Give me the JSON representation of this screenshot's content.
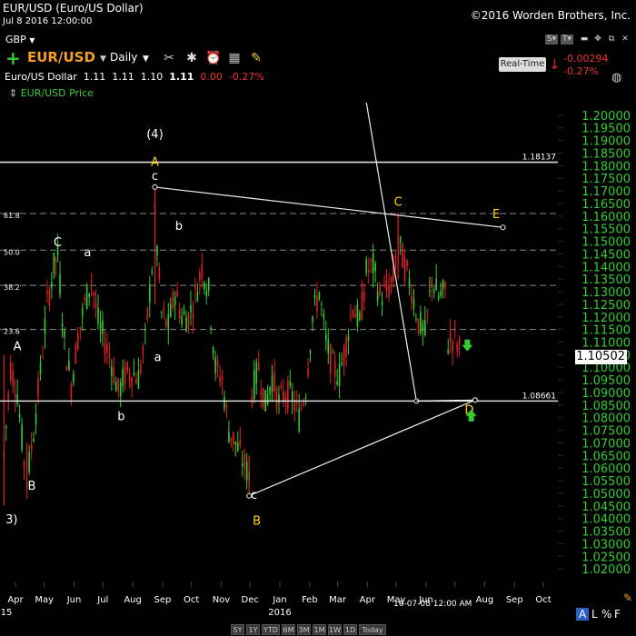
{
  "header": {
    "title": "EUR/USD (Euro/US Dollar)",
    "date": "Jul 8 2016 12:00:00",
    "copyright": "©2016 Worden Brothers, Inc.",
    "currency": "GBP",
    "symbol": "EUR/USD",
    "period": "Daily",
    "ohlc": {
      "name": "Euro/US Dollar",
      "open": "1.11",
      "high": "1.11",
      "low": "1.10",
      "close": "1.11",
      "change": "0.00",
      "change_pct": "-0.27%"
    },
    "realtime_label": "Real-Time",
    "change_abs": "-0.00294",
    "change_pct": "-0.27%",
    "legend": "EUR/USD Price"
  },
  "toolbar_icons": [
    "plus-icon",
    "tools-icon",
    "alarm-icon",
    "calculator-icon",
    "note-icon"
  ],
  "window_buttons": [
    "S▾",
    "T▾",
    "▬",
    "✥",
    "⧉",
    "✕"
  ],
  "bottom_buttons": [
    "5Y",
    "1Y",
    "YTD",
    "6M",
    "3M",
    "1M",
    "1W",
    "1D",
    "Today"
  ],
  "current_price_label": "1.10502",
  "cursor_date": "16-07-08 12:00 AM",
  "alf": [
    "A",
    "L",
    "%",
    "F"
  ],
  "colors": {
    "up": "#33cc33",
    "down": "#e02020",
    "axis_text": "#33cc33",
    "wave_yellow": "#ffd700"
  },
  "chart_data": {
    "type": "candlestick",
    "ylim": [
      1.015,
      1.205
    ],
    "y_ticks": [
      "1.20000",
      "1.19500",
      "1.19000",
      "1.18500",
      "1.18000",
      "1.17500",
      "1.17000",
      "1.16500",
      "1.16000",
      "1.15500",
      "1.15000",
      "1.14500",
      "1.14000",
      "1.13500",
      "1.13000",
      "1.12500",
      "1.12000",
      "1.11500",
      "1.11000",
      "1.10500",
      "1.10000",
      "1.09500",
      "1.09000",
      "1.08500",
      "1.08000",
      "1.07500",
      "1.07000",
      "1.06500",
      "1.06000",
      "1.05500",
      "1.05000",
      "1.04500",
      "1.04000",
      "1.03500",
      "1.03000",
      "1.02500",
      "1.02000"
    ],
    "x_ticks": [
      {
        "label": "Apr",
        "sub": "15"
      },
      {
        "label": "May"
      },
      {
        "label": "Jun"
      },
      {
        "label": "Jul"
      },
      {
        "label": "Aug"
      },
      {
        "label": "Sep"
      },
      {
        "label": "Oct"
      },
      {
        "label": "Nov"
      },
      {
        "label": "Dec"
      },
      {
        "label": "Jan",
        "sub": "2016"
      },
      {
        "label": "Feb"
      },
      {
        "label": "Mar"
      },
      {
        "label": "Apr"
      },
      {
        "label": "May"
      },
      {
        "label": "Jun"
      },
      {
        "label": "Jul"
      },
      {
        "label": "Aug"
      },
      {
        "label": "Sep"
      },
      {
        "label": "Oct"
      }
    ],
    "horizontal_lines": [
      {
        "value": 1.18137,
        "label": "1.18137"
      },
      {
        "value": 1.08661,
        "label": "1.08661"
      }
    ],
    "fib_levels": [
      {
        "value": 1.161,
        "label": "61.8"
      },
      {
        "value": 1.1465,
        "label": "50.0"
      },
      {
        "value": 1.1325,
        "label": "38.2"
      },
      {
        "value": 1.115,
        "label": "23.6"
      }
    ],
    "wave_labels": [
      {
        "text": "(4)",
        "color": "white",
        "date": "2015-08-24",
        "price": 1.191
      },
      {
        "text": "A",
        "color": "yellow",
        "date": "2015-08-24",
        "price": 1.18
      },
      {
        "text": "c",
        "color": "white",
        "date": "2015-08-24",
        "price": 1.1743
      },
      {
        "text": "C",
        "color": "white",
        "date": "2015-05-15",
        "price": 1.148
      },
      {
        "text": "a",
        "color": "white",
        "date": "2015-06-15",
        "price": 1.144
      },
      {
        "text": "b",
        "color": "white",
        "date": "2015-09-18",
        "price": 1.1545
      },
      {
        "text": "a",
        "color": "white",
        "date": "2015-08-27",
        "price": 1.1025
      },
      {
        "text": "b",
        "color": "white",
        "date": "2015-07-20",
        "price": 1.079
      },
      {
        "text": "A",
        "color": "white",
        "date": "2015-04-03",
        "price": 1.1068
      },
      {
        "text": "B",
        "color": "white",
        "date": "2015-04-18",
        "price": 1.0515
      },
      {
        "text": "3)",
        "color": "white",
        "date": "2015-03-28",
        "price": 1.038
      },
      {
        "text": "c",
        "color": "white",
        "date": "2015-12-05",
        "price": 1.0478
      },
      {
        "text": "B",
        "color": "yellow",
        "date": "2015-12-08",
        "price": 1.0375
      },
      {
        "text": "C",
        "color": "yellow",
        "date": "2016-05-03",
        "price": 1.164
      },
      {
        "text": "E",
        "color": "yellow",
        "date": "2016-08-13",
        "price": 1.1592
      },
      {
        "text": "D",
        "color": "yellow",
        "date": "2016-07-16",
        "price": 1.0815
      }
    ],
    "trendlines": [
      {
        "from": {
          "date": "2015-08-24",
          "price": 1.1715
        },
        "to": {
          "date": "2016-08-20",
          "price": 1.1555
        }
      },
      {
        "from": {
          "date": "2015-11-30",
          "price": 1.049
        },
        "to": {
          "date": "2016-07-22",
          "price": 1.087
        }
      },
      {
        "from": {
          "date": "2016-03-31",
          "price": 1.205
        },
        "to": {
          "date": "2016-05-22",
          "price": 1.0866
        }
      },
      {
        "from": {
          "date": "2016-05-22",
          "price": 1.0866
        },
        "to": {
          "date": "2016-07-22",
          "price": 1.087
        }
      }
    ],
    "arrows": [
      {
        "direction": "down",
        "color": "green",
        "date": "2016-07-14",
        "price": 1.1085
      },
      {
        "direction": "up",
        "color": "green",
        "date": "2016-07-18",
        "price": 1.081
      }
    ],
    "closes": [
      {
        "date": "2015-03-20",
        "close": 1.065
      },
      {
        "date": "2015-03-27",
        "close": 1.1
      },
      {
        "date": "2015-04-03",
        "close": 1.09
      },
      {
        "date": "2015-04-10",
        "close": 1.062
      },
      {
        "date": "2015-04-13",
        "close": 1.055
      },
      {
        "date": "2015-04-20",
        "close": 1.075
      },
      {
        "date": "2015-04-27",
        "close": 1.098
      },
      {
        "date": "2015-05-04",
        "close": 1.125
      },
      {
        "date": "2015-05-11",
        "close": 1.14
      },
      {
        "date": "2015-05-15",
        "close": 1.145
      },
      {
        "date": "2015-05-22",
        "close": 1.11
      },
      {
        "date": "2015-05-29",
        "close": 1.093
      },
      {
        "date": "2015-06-05",
        "close": 1.112
      },
      {
        "date": "2015-06-12",
        "close": 1.125
      },
      {
        "date": "2015-06-19",
        "close": 1.135
      },
      {
        "date": "2015-06-26",
        "close": 1.118
      },
      {
        "date": "2015-07-03",
        "close": 1.11
      },
      {
        "date": "2015-07-10",
        "close": 1.102
      },
      {
        "date": "2015-07-17",
        "close": 1.09
      },
      {
        "date": "2015-07-24",
        "close": 1.097
      },
      {
        "date": "2015-07-31",
        "close": 1.098
      },
      {
        "date": "2015-08-07",
        "close": 1.096
      },
      {
        "date": "2015-08-14",
        "close": 1.11
      },
      {
        "date": "2015-08-21",
        "close": 1.14
      },
      {
        "date": "2015-08-24",
        "close": 1.16
      },
      {
        "date": "2015-08-31",
        "close": 1.121
      },
      {
        "date": "2015-09-07",
        "close": 1.116
      },
      {
        "date": "2015-09-14",
        "close": 1.13
      },
      {
        "date": "2015-09-21",
        "close": 1.12
      },
      {
        "date": "2015-09-28",
        "close": 1.12
      },
      {
        "date": "2015-10-05",
        "close": 1.128
      },
      {
        "date": "2015-10-12",
        "close": 1.14
      },
      {
        "date": "2015-10-19",
        "close": 1.13
      },
      {
        "date": "2015-10-26",
        "close": 1.1
      },
      {
        "date": "2015-11-02",
        "close": 1.095
      },
      {
        "date": "2015-11-09",
        "close": 1.075
      },
      {
        "date": "2015-11-16",
        "close": 1.07
      },
      {
        "date": "2015-11-23",
        "close": 1.063
      },
      {
        "date": "2015-11-30",
        "close": 1.057
      },
      {
        "date": "2015-12-03",
        "close": 1.09
      },
      {
        "date": "2015-12-10",
        "close": 1.1
      },
      {
        "date": "2015-12-17",
        "close": 1.085
      },
      {
        "date": "2015-12-24",
        "close": 1.096
      },
      {
        "date": "2015-12-31",
        "close": 1.086
      },
      {
        "date": "2016-01-07",
        "close": 1.09
      },
      {
        "date": "2016-01-14",
        "close": 1.088
      },
      {
        "date": "2016-01-21",
        "close": 1.08
      },
      {
        "date": "2016-01-28",
        "close": 1.092
      },
      {
        "date": "2016-02-04",
        "close": 1.12
      },
      {
        "date": "2016-02-11",
        "close": 1.13
      },
      {
        "date": "2016-02-18",
        "close": 1.11
      },
      {
        "date": "2016-02-25",
        "close": 1.1
      },
      {
        "date": "2016-03-03",
        "close": 1.097
      },
      {
        "date": "2016-03-10",
        "close": 1.11
      },
      {
        "date": "2016-03-17",
        "close": 1.125
      },
      {
        "date": "2016-03-24",
        "close": 1.117
      },
      {
        "date": "2016-03-31",
        "close": 1.138
      },
      {
        "date": "2016-04-07",
        "close": 1.14
      },
      {
        "date": "2016-04-14",
        "close": 1.128
      },
      {
        "date": "2016-04-21",
        "close": 1.13
      },
      {
        "date": "2016-04-28",
        "close": 1.135
      },
      {
        "date": "2016-05-03",
        "close": 1.15
      },
      {
        "date": "2016-05-10",
        "close": 1.14
      },
      {
        "date": "2016-05-17",
        "close": 1.131
      },
      {
        "date": "2016-05-24",
        "close": 1.118
      },
      {
        "date": "2016-05-31",
        "close": 1.113
      },
      {
        "date": "2016-06-07",
        "close": 1.135
      },
      {
        "date": "2016-06-14",
        "close": 1.128
      },
      {
        "date": "2016-06-21",
        "close": 1.13
      },
      {
        "date": "2016-06-24",
        "close": 1.11
      },
      {
        "date": "2016-07-01",
        "close": 1.112
      },
      {
        "date": "2016-07-08",
        "close": 1.105
      }
    ]
  }
}
